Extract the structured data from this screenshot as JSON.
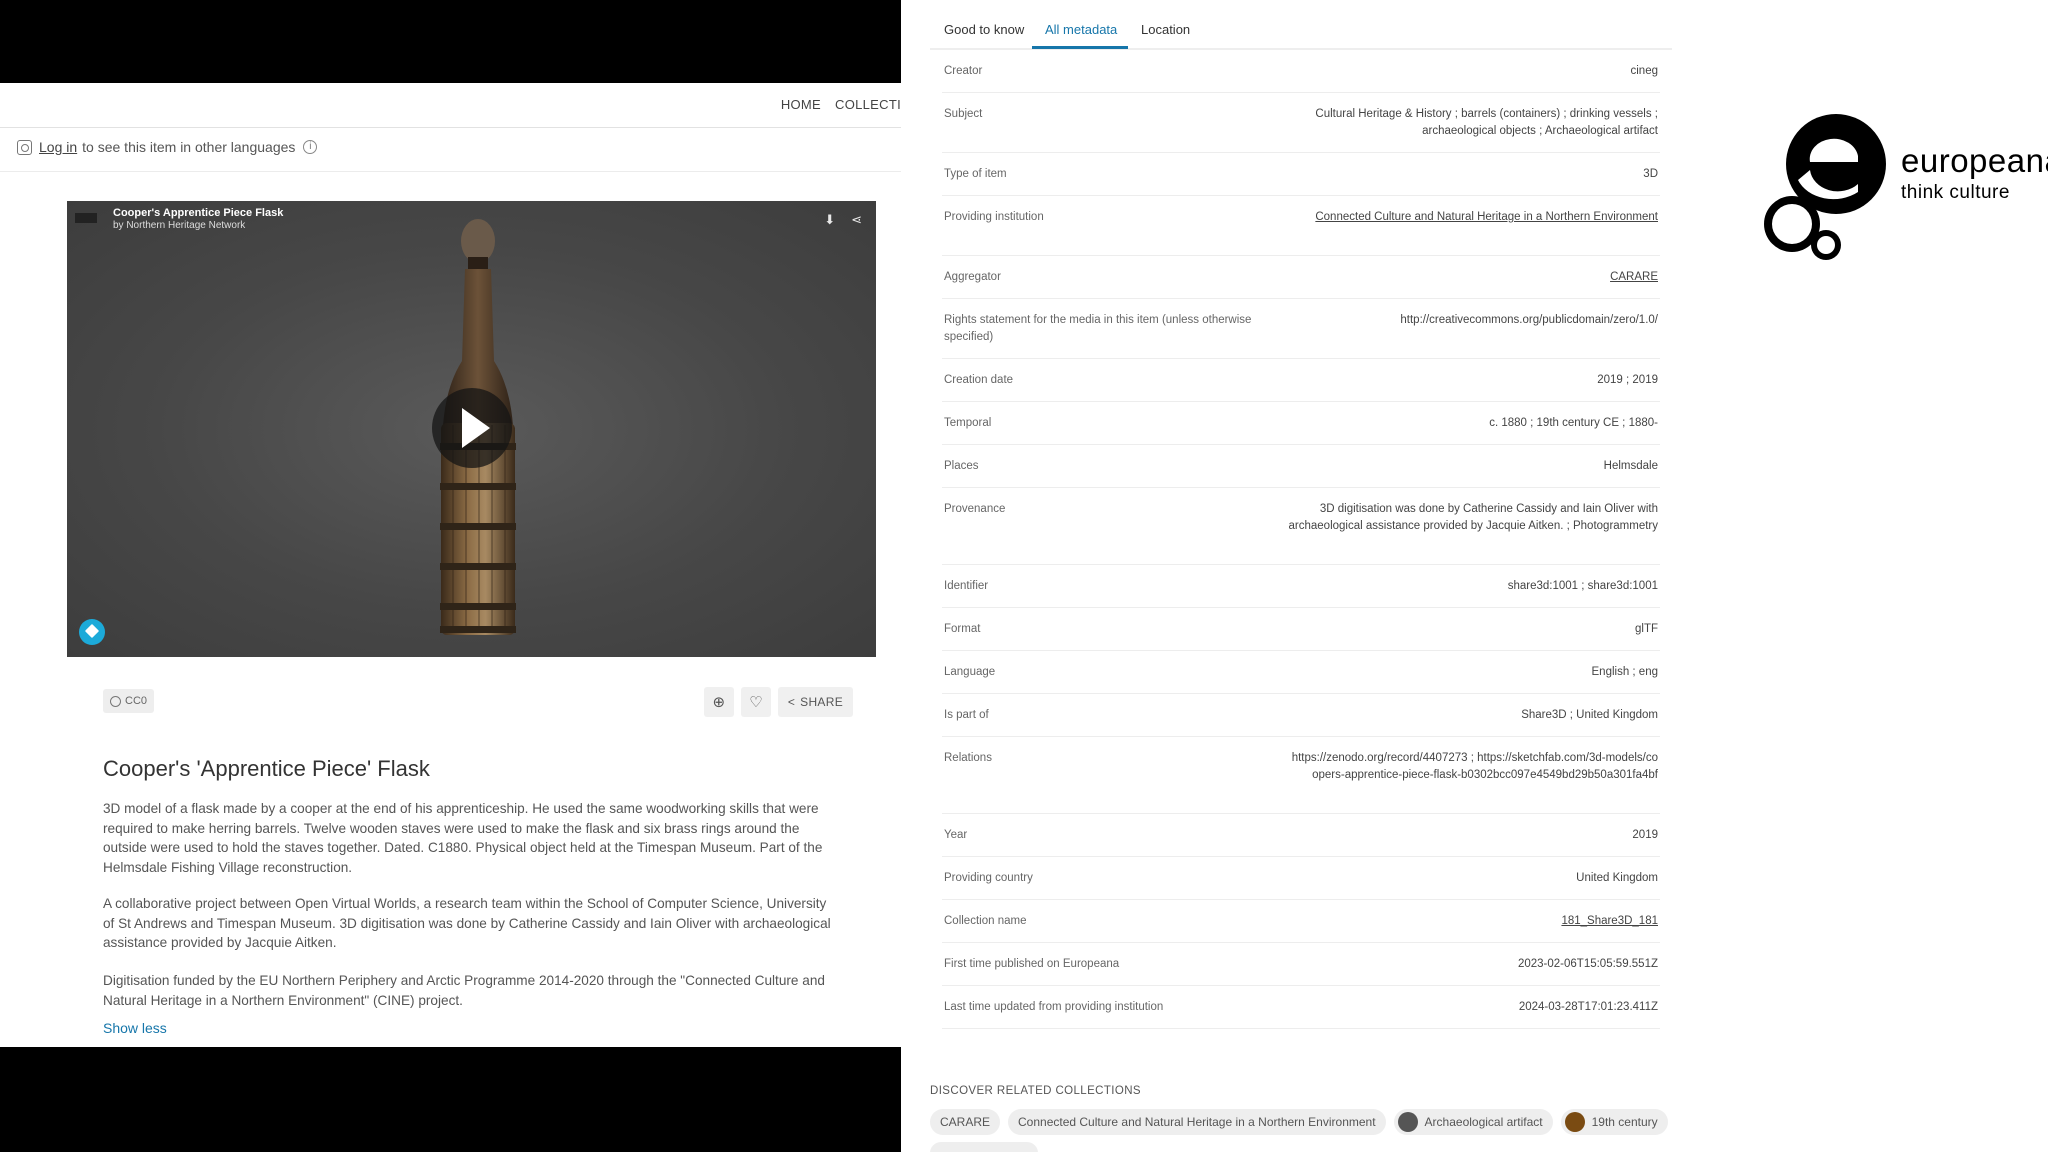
{
  "nav": {
    "items": [
      "HOME",
      "COLLECTI"
    ]
  },
  "language_bar": {
    "login_link": "Log in",
    "message": "to see this item in other languages"
  },
  "viewer": {
    "title": "Cooper's Apprentice Piece Flask",
    "byline": "by Northern Heritage Network",
    "download_icon": "download-icon",
    "share_icon": "share-icon",
    "play_icon": "play-icon",
    "badge_icon": "sketchfab-icon"
  },
  "rights_badge": "CC0",
  "actions": {
    "add_icon": "add-circle-icon",
    "like_icon": "heart-icon",
    "share_label": "SHARE"
  },
  "item": {
    "title": "Cooper's 'Apprentice Piece' Flask",
    "description": [
      "3D model of a flask made by a cooper at the end of his apprenticeship. He used the same woodworking skills that were required to make herring barrels. Twelve wooden staves were used to make the flask and six brass rings around the outside were used to hold the staves together. Dated. C1880. Physical object held at the Timespan Museum. Part of the Helmsdale Fishing Village reconstruction.",
      "A collaborative project between Open Virtual Worlds, a research team within the School of Computer Science, University of St Andrews and Timespan Museum. 3D digitisation was done by Catherine Cassidy and Iain Oliver with archaeological assistance provided by Jacquie Aitken.",
      "Digitisation funded by the EU Northern Periphery and Arctic Programme 2014-2020 through the \"Connected Culture and Natural Heritage in a Northern Environment\" (CINE) project."
    ],
    "show_less": "Show less"
  },
  "tabs": [
    "Good to know",
    "All metadata",
    "Location"
  ],
  "active_tab": "All metadata",
  "metadata": [
    {
      "label": "Creator",
      "value": "cineg",
      "link": false
    },
    {
      "label": "Subject",
      "value": "Cultural Heritage & History ; barrels (containers) ; drinking vessels ; archaeological objects ; Archaeological artifact",
      "link": false
    },
    {
      "label": "Type of item",
      "value": "3D",
      "link": false
    },
    {
      "label": "Providing institution",
      "value": "Connected Culture and Natural Heritage in a Northern Environment",
      "link": true
    },
    {
      "label": "Aggregator",
      "value": "CARARE",
      "link": true
    },
    {
      "label": "Rights statement for the media in this item (unless otherwise specified)",
      "value": "http://creativecommons.org/publicdomain/zero/1.0/",
      "link": false
    },
    {
      "label": "Creation date",
      "value": "2019 ; 2019",
      "link": false
    },
    {
      "label": "Temporal",
      "value": "c. 1880 ; 19th century CE ; 1880-",
      "link": false
    },
    {
      "label": "Places",
      "value": "Helmsdale",
      "link": false
    },
    {
      "label": "Provenance",
      "value": "3D digitisation was done by Catherine Cassidy and Iain Oliver with archaeological assistance provided by Jacquie Aitken. ; Photogrammetry",
      "link": false
    },
    {
      "label": "Identifier",
      "value": "share3d:1001 ; share3d:1001",
      "link": false
    },
    {
      "label": "Format",
      "value": "glTF",
      "link": false
    },
    {
      "label": "Language",
      "value": "English ; eng",
      "link": false
    },
    {
      "label": "Is part of",
      "value": "Share3D ; United Kingdom",
      "link": false
    },
    {
      "label": "Relations",
      "value": "https://zenodo.org/record/4407273 ; https://sketchfab.com/3d-models/coopers-apprentice-piece-flask-b0302bcc097e4549bd29b50a301fa4bf",
      "link": false
    },
    {
      "label": "Year",
      "value": "2019",
      "link": false
    },
    {
      "label": "Providing country",
      "value": "United Kingdom",
      "link": false
    },
    {
      "label": "Collection name",
      "value": "181_Share3D_181",
      "link": true
    },
    {
      "label": "First time published on Europeana",
      "value": "2023-02-06T15:05:59.551Z",
      "link": false
    },
    {
      "label": "Last time updated from providing institution",
      "value": "2024-03-28T17:01:23.411Z",
      "link": false
    }
  ],
  "related": {
    "heading": "DISCOVER RELATED COLLECTIONS",
    "chips": [
      {
        "label": "CARARE",
        "thumb": ""
      },
      {
        "label": "Connected Culture and Natural Heritage in a Northern Environment",
        "thumb": ""
      },
      {
        "label": "Archaeological artifact",
        "thumb": "#555555"
      },
      {
        "label": "19th century",
        "thumb": "#7a4b12"
      }
    ]
  },
  "logo": {
    "word": "europeana",
    "tagline": "think culture"
  },
  "colors": {
    "accent": "#1676aa",
    "viewer_bg": "#474747",
    "badge": "#1caad9"
  }
}
